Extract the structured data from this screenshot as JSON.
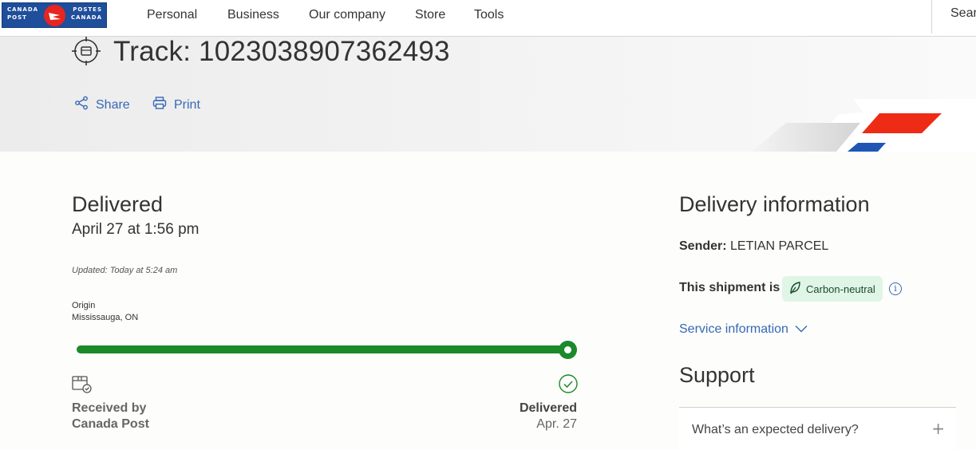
{
  "nav": {
    "logo": {
      "left_top": "CANADA",
      "left_bottom": "POST",
      "right_top": "POSTES",
      "right_bottom": "CANADA"
    },
    "items": [
      {
        "label": "Personal"
      },
      {
        "label": "Business"
      },
      {
        "label": "Our company"
      },
      {
        "label": "Store"
      },
      {
        "label": "Tools"
      }
    ],
    "search_label": "Sear"
  },
  "header": {
    "title": "Track: 1023038907362493",
    "share_label": "Share",
    "print_label": "Print"
  },
  "status": {
    "title": "Delivered",
    "date": "April 27 at 1:56 pm",
    "updated": "Updated: Today at 5:24 am",
    "origin_label": "Origin",
    "origin_value": "Mississauga, ON",
    "progress_fraction": 1.0,
    "start_step": {
      "line1": "Received by",
      "line2": "Canada Post",
      "icon": "package-icon"
    },
    "end_step": {
      "label": "Delivered",
      "date": "Apr. 27",
      "icon": "check-circle-icon"
    }
  },
  "delivery_info": {
    "title": "Delivery information",
    "sender_label": "Sender:",
    "sender_value": "LETIAN PARCEL",
    "shipment_label": "This shipment is",
    "shipment_badge": "Carbon-neutral",
    "service_link": "Service information"
  },
  "support": {
    "title": "Support",
    "faq": [
      {
        "question": "What’s an expected delivery?"
      }
    ]
  },
  "colors": {
    "accent_blue": "#3768b5",
    "progress_green": "#1a8a2a",
    "brand_red": "#e8251e",
    "brand_blue": "#1f4e9b",
    "badge_bg": "#dff5e6"
  }
}
